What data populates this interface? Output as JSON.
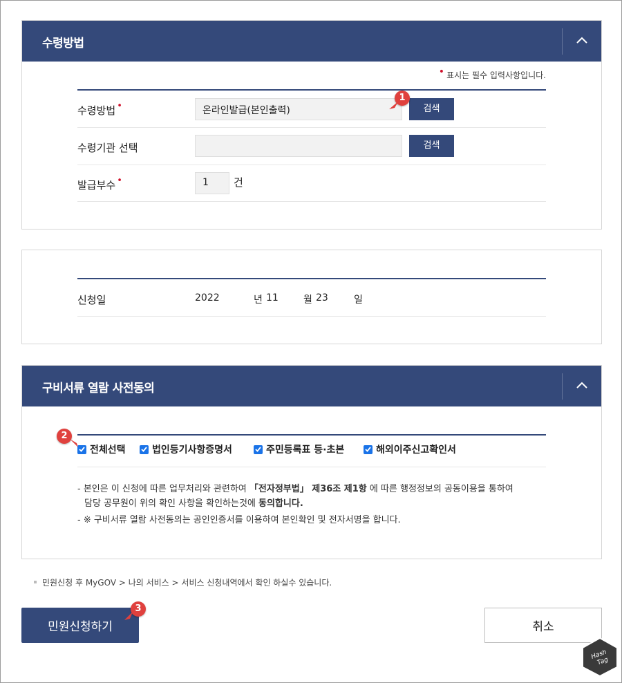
{
  "receipt": {
    "title": "수령방법",
    "required_note": "표시는 필수 입력사항입니다.",
    "method_label": "수령방법",
    "method_value": "온라인발급(본인출력)",
    "method_search": "검색",
    "agency_label": "수령기관 선택",
    "agency_value": "",
    "agency_search": "검색",
    "copies_label": "발급부수",
    "copies_value": "1",
    "copies_unit": "건"
  },
  "application": {
    "date_label": "신청일",
    "year": "2022",
    "year_unit": "년",
    "month": "11",
    "month_unit": "월",
    "day": "23",
    "day_unit": "일"
  },
  "consent": {
    "title": "구비서류 열람 사전동의",
    "checkboxes": [
      {
        "label": "전체선택",
        "checked": true
      },
      {
        "label": "법인등기사항증명서",
        "checked": true
      },
      {
        "label": "주민등록표 등·초본",
        "checked": true
      },
      {
        "label": "해외이주신고확인서",
        "checked": true
      }
    ],
    "note1_a": "- 본인은 이 신청에 따른 업무처리와 관련하여 ",
    "note1_b": "「전자정부법」 제36조 제1항",
    "note1_c": " 에 따른 행정정보의 공동이용을 통하여",
    "note1_d": "담당 공무원이 위의 확인 사항을 확인하는것에 ",
    "note1_e": "동의합니다.",
    "note2": "- ※ 구비서류 열람 사전동의는 공인인증서를 이용하여 본인확인 및 전자서명을 합니다."
  },
  "footer": {
    "info": "민원신청 후 MyGOV > 나의 서비스 > 서비스 신청내역에서 확인 하실수 있습니다.",
    "submit_label": "민원신청하기",
    "cancel_label": "취소"
  },
  "badges": [
    "1",
    "2",
    "3"
  ],
  "watermark": {
    "line1": "Hash",
    "line2": "Tag"
  },
  "colors": {
    "header": "#34497a",
    "required": "#d0112b",
    "badge": "#e0413e",
    "checkbox": "#1a73e8"
  }
}
